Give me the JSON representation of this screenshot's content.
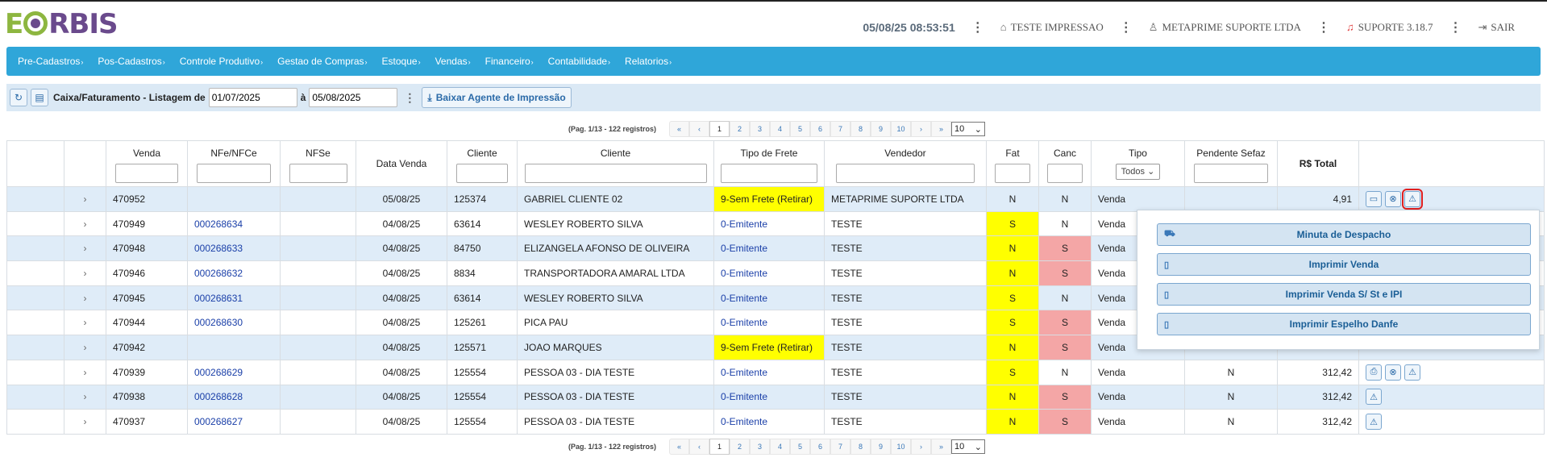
{
  "header": {
    "logo": {
      "e": "E",
      "rest": "RBIS"
    },
    "datetime": "05/08/25 08:53:51",
    "printer": "TESTE IMPRESSAO",
    "user": "METAPRIME SUPORTE LTDA",
    "support": "SUPORTE 3.18.7",
    "logout": "SAIR"
  },
  "nav": [
    "Pre-Cadastros",
    "Pos-Cadastros",
    "Controle Produtivo",
    "Gestao de Compras",
    "Estoque",
    "Vendas",
    "Financeiro",
    "Contabilidade",
    "Relatorios"
  ],
  "toolbar": {
    "title": "Caixa/Faturamento - Listagem de",
    "date_from": "01/07/2025",
    "sep": "à",
    "date_to": "05/08/2025",
    "agent_button": "Baixar Agente de Impressão"
  },
  "pagination": {
    "info": "(Pag. 1/13 - 122 registros)",
    "pages": [
      "«",
      "‹",
      "1",
      "2",
      "3",
      "4",
      "5",
      "6",
      "7",
      "8",
      "9",
      "10",
      "›",
      "»"
    ],
    "page_size": "10"
  },
  "table": {
    "headers": {
      "venda": "Venda",
      "nfe": "NFe/NFCe",
      "nfse": "NFSe",
      "data": "Data Venda",
      "cliente_cod": "Cliente",
      "cliente": "Cliente",
      "frete": "Tipo de Frete",
      "vendedor": "Vendedor",
      "fat": "Fat",
      "canc": "Canc",
      "tipo": "Tipo",
      "tipo_filter": "Todos",
      "pendente": "Pendente Sefaz",
      "total": "R$ Total"
    },
    "rows": [
      {
        "venda": "470952",
        "nfe": "",
        "data": "05/08/25",
        "cod": "125374",
        "cliente": "GABRIEL CLIENTE 02",
        "frete": "9-Sem Frete (Retirar)",
        "vendedor": "METAPRIME SUPORTE LTDA",
        "fat": "N",
        "canc": "N",
        "tipo": "Venda",
        "pendente": "",
        "total": "4,91"
      },
      {
        "venda": "470949",
        "nfe": "000268634",
        "data": "04/08/25",
        "cod": "63614",
        "cliente": "WESLEY ROBERTO SILVA",
        "frete": "0-Emitente",
        "vendedor": "TESTE",
        "fat": "S",
        "canc": "N",
        "tipo": "Venda",
        "pendente": "",
        "total": ""
      },
      {
        "venda": "470948",
        "nfe": "000268633",
        "data": "04/08/25",
        "cod": "84750",
        "cliente": "ELIZANGELA AFONSO DE OLIVEIRA",
        "frete": "0-Emitente",
        "vendedor": "TESTE",
        "fat": "N",
        "canc": "S",
        "tipo": "Venda",
        "pendente": "",
        "total": ""
      },
      {
        "venda": "470946",
        "nfe": "000268632",
        "data": "04/08/25",
        "cod": "8834",
        "cliente": "TRANSPORTADORA AMARAL LTDA",
        "frete": "0-Emitente",
        "vendedor": "TESTE",
        "fat": "N",
        "canc": "S",
        "tipo": "Venda",
        "pendente": "",
        "total": ""
      },
      {
        "venda": "470945",
        "nfe": "000268631",
        "data": "04/08/25",
        "cod": "63614",
        "cliente": "WESLEY ROBERTO SILVA",
        "frete": "0-Emitente",
        "vendedor": "TESTE",
        "fat": "S",
        "canc": "N",
        "tipo": "Venda",
        "pendente": "",
        "total": ""
      },
      {
        "venda": "470944",
        "nfe": "000268630",
        "data": "04/08/25",
        "cod": "125261",
        "cliente": "PICA PAU",
        "frete": "0-Emitente",
        "vendedor": "TESTE",
        "fat": "S",
        "canc": "S",
        "tipo": "Venda",
        "pendente": "",
        "total": ""
      },
      {
        "venda": "470942",
        "nfe": "",
        "data": "04/08/25",
        "cod": "125571",
        "cliente": "JOAO MARQUES",
        "frete": "9-Sem Frete (Retirar)",
        "vendedor": "TESTE",
        "fat": "N",
        "canc": "S",
        "tipo": "Venda",
        "pendente": "",
        "total": ""
      },
      {
        "venda": "470939",
        "nfe": "000268629",
        "data": "04/08/25",
        "cod": "125554",
        "cliente": "PESSOA 03 - DIA TESTE",
        "frete": "0-Emitente",
        "vendedor": "TESTE",
        "fat": "S",
        "canc": "N",
        "tipo": "Venda",
        "pendente": "N",
        "total": "312,42"
      },
      {
        "venda": "470938",
        "nfe": "000268628",
        "data": "04/08/25",
        "cod": "125554",
        "cliente": "PESSOA 03 - DIA TESTE",
        "frete": "0-Emitente",
        "vendedor": "TESTE",
        "fat": "N",
        "canc": "S",
        "tipo": "Venda",
        "pendente": "N",
        "total": "312,42"
      },
      {
        "venda": "470937",
        "nfe": "000268627",
        "data": "04/08/25",
        "cod": "125554",
        "cliente": "PESSOA 03 - DIA TESTE",
        "frete": "0-Emitente",
        "vendedor": "TESTE",
        "fat": "N",
        "canc": "S",
        "tipo": "Venda",
        "pendente": "N",
        "total": "312,42"
      }
    ]
  },
  "menu": {
    "items": [
      {
        "label": "Minuta de Despacho",
        "icon": "truck-icon"
      },
      {
        "label": "Imprimir Venda",
        "icon": "file-icon"
      },
      {
        "label": "Imprimir Venda S/ St e IPI",
        "icon": "file-icon"
      },
      {
        "label": "Imprimir Espelho Danfe",
        "icon": "file-icon"
      }
    ]
  },
  "colors": {
    "nav": "#2fa6d9",
    "row_alt": "#dfecf8",
    "yellow": "#ffff00",
    "pink": "#f4a6a6",
    "link": "#1a3fa8"
  }
}
